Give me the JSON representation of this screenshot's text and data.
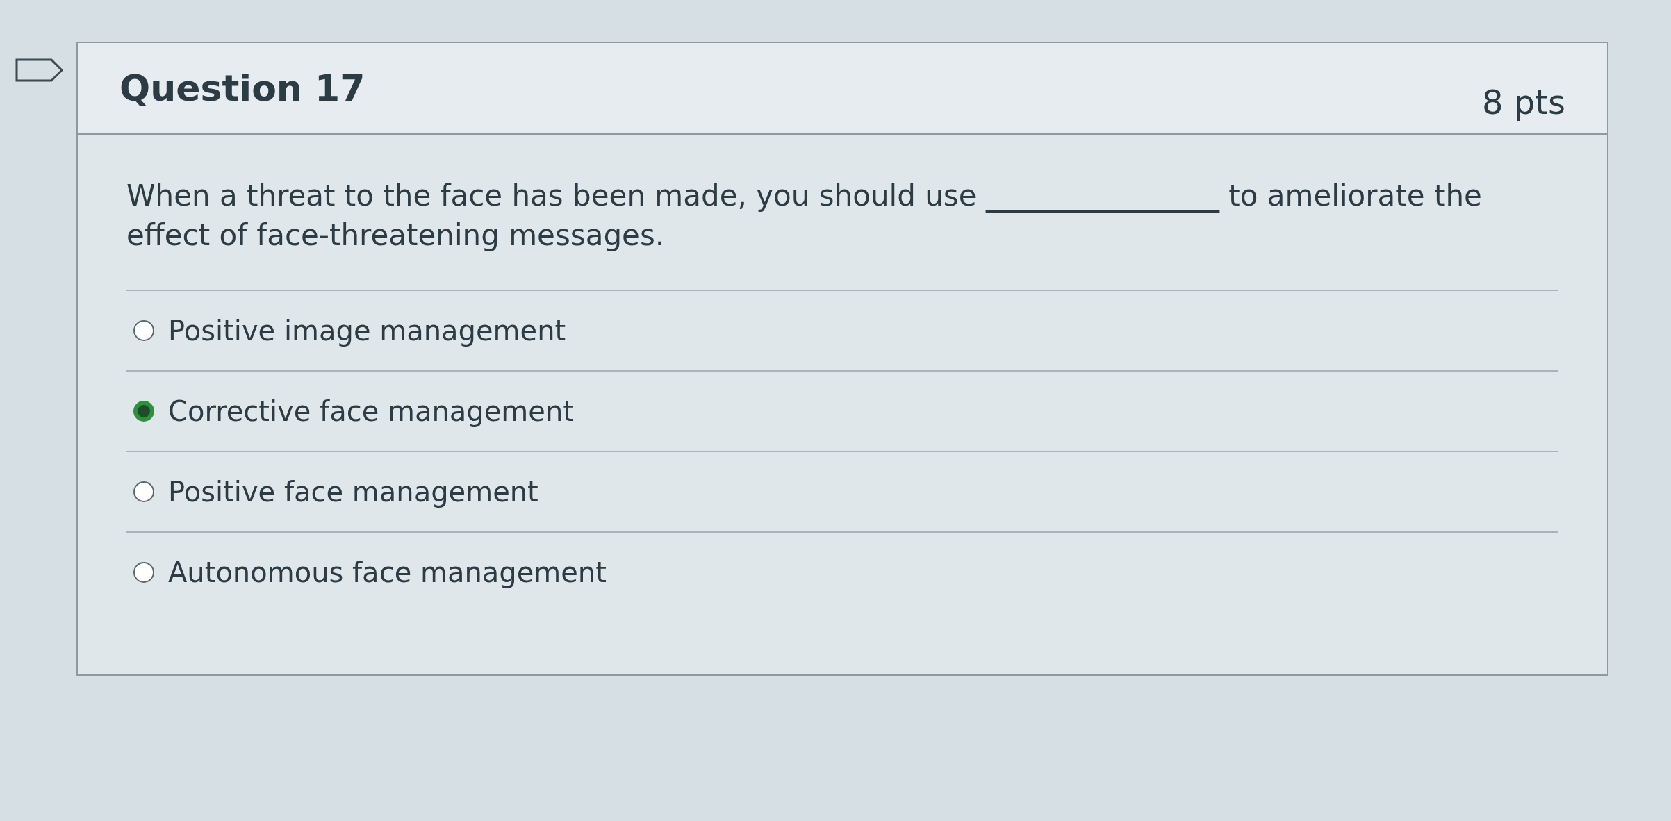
{
  "question": {
    "title": "Question 17",
    "points": "8 pts",
    "prompt": "When a threat to the face has been made, you should use ________________ to ameliorate the effect of face-threatening messages."
  },
  "answers": [
    {
      "label": "Positive image management",
      "selected": false
    },
    {
      "label": "Corrective face management",
      "selected": true
    },
    {
      "label": "Positive face management",
      "selected": false
    },
    {
      "label": "Autonomous face management",
      "selected": false
    }
  ]
}
